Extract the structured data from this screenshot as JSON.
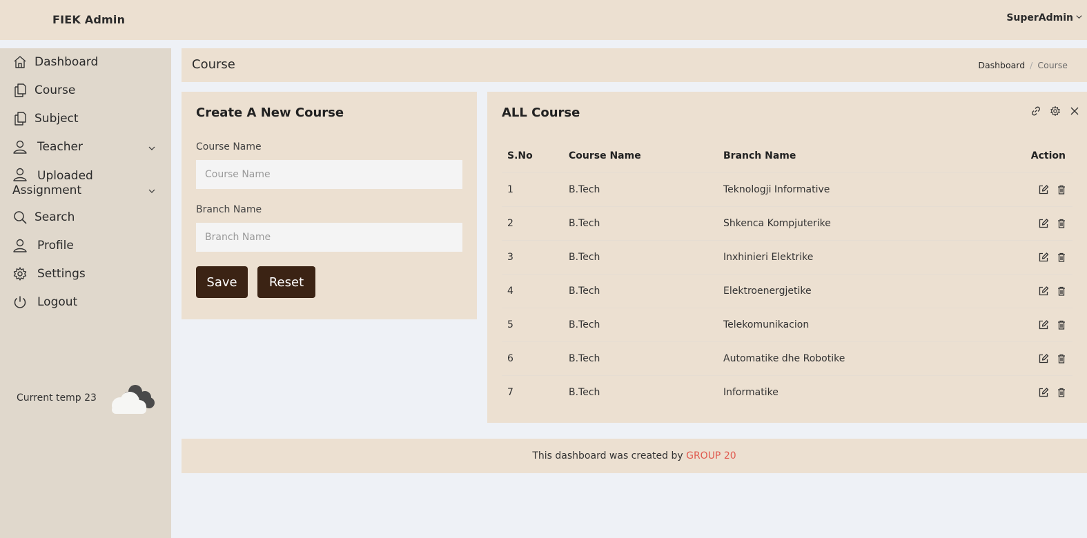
{
  "header": {
    "brand": "FIEK Admin",
    "user": "SuperAdmin"
  },
  "sidebar": {
    "items": [
      {
        "label": "Dashboard",
        "icon": "home-icon"
      },
      {
        "label": "Course",
        "icon": "document-copy-icon"
      },
      {
        "label": "Subject",
        "icon": "document-copy-icon"
      },
      {
        "label": "Teacher",
        "icon": "user-icon",
        "has_submenu": true
      },
      {
        "label_line1": "Uploaded",
        "label_line2": "Assignment",
        "icon": "user-icon",
        "has_submenu": true
      },
      {
        "label": "Search",
        "icon": "search-icon"
      },
      {
        "label": "Profile",
        "icon": "user-icon"
      },
      {
        "label": "Settings",
        "icon": "gear-icon"
      },
      {
        "label": "Logout",
        "icon": "power-icon"
      }
    ],
    "weather": {
      "text": "Current temp 23",
      "icon": "cloud-icon"
    }
  },
  "page": {
    "title": "Course",
    "breadcrumb": {
      "home": "Dashboard",
      "separator": "/",
      "current": "Course"
    }
  },
  "form": {
    "title": "Create A New Course",
    "course_label": "Course Name",
    "course_placeholder": "Course Name",
    "course_value": "",
    "branch_label": "Branch Name",
    "branch_placeholder": "Branch Name",
    "branch_value": "",
    "save_label": "Save",
    "reset_label": "Reset"
  },
  "table": {
    "title": "ALL Course",
    "tool_icons": [
      "link-icon",
      "gear-icon",
      "close-icon"
    ],
    "columns": [
      "S.No",
      "Course Name",
      "Branch Name",
      "Action"
    ],
    "action_icons": [
      "edit-icon",
      "trash-icon"
    ],
    "rows": [
      {
        "sno": "1",
        "course": "B.Tech",
        "branch": "Teknologji Informative"
      },
      {
        "sno": "2",
        "course": "B.Tech",
        "branch": "Shkenca Kompjuterike"
      },
      {
        "sno": "3",
        "course": "B.Tech",
        "branch": "Inxhinieri Elektrike"
      },
      {
        "sno": "4",
        "course": "B.Tech",
        "branch": "Elektroenergjetike"
      },
      {
        "sno": "5",
        "course": "B.Tech",
        "branch": "Telekomunikacion"
      },
      {
        "sno": "6",
        "course": "B.Tech",
        "branch": "Automatike dhe Robotike"
      },
      {
        "sno": "7",
        "course": "B.Tech",
        "branch": "Informatike"
      }
    ]
  },
  "footer": {
    "text": "This dashboard was created by ",
    "highlight": "GROUP 20"
  },
  "colors": {
    "panel": "#ece0d1",
    "sidebar": "#e0d8cc",
    "background": "#eef1f6",
    "button": "#3b2314",
    "footer_accent": "#e05a4f"
  }
}
